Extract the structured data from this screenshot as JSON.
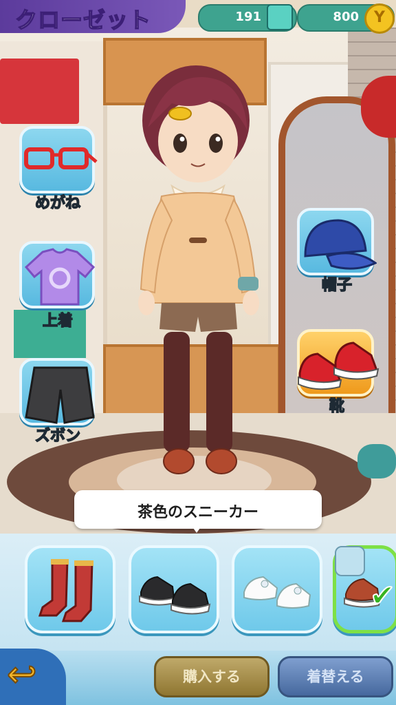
{
  "header": {
    "title": "クローゼット",
    "currency1": "191",
    "currency2": "800",
    "coin_symbol": "Y"
  },
  "categories": [
    {
      "label": "めがね",
      "icon": "glasses-icon"
    },
    {
      "label": "上着",
      "icon": "shirt-icon"
    },
    {
      "label": "ズボン",
      "icon": "shorts-icon"
    },
    {
      "label": "帽子",
      "icon": "cap-icon"
    },
    {
      "label": "靴",
      "icon": "sneakers-icon",
      "selected": true
    }
  ],
  "tooltip": {
    "text": "茶色のスニーカー"
  },
  "items": [
    {
      "icon": "red-boots-icon"
    },
    {
      "icon": "black-sneakers-icon"
    },
    {
      "icon": "white-ribbon-shoes-icon"
    },
    {
      "icon": "brown-sneakers-icon",
      "equipped": true
    }
  ],
  "buttons": {
    "buy": "購入する",
    "change": "着替える",
    "back_icon": "back-arrow-icon"
  },
  "colors": {
    "header_purple": "#5c3b9c",
    "category_blue": "#58b9e0",
    "category_selected": "#ef9a1c",
    "buy_button": "#8f7631",
    "change_button": "#46689e",
    "equipped_border": "#7ee046"
  }
}
